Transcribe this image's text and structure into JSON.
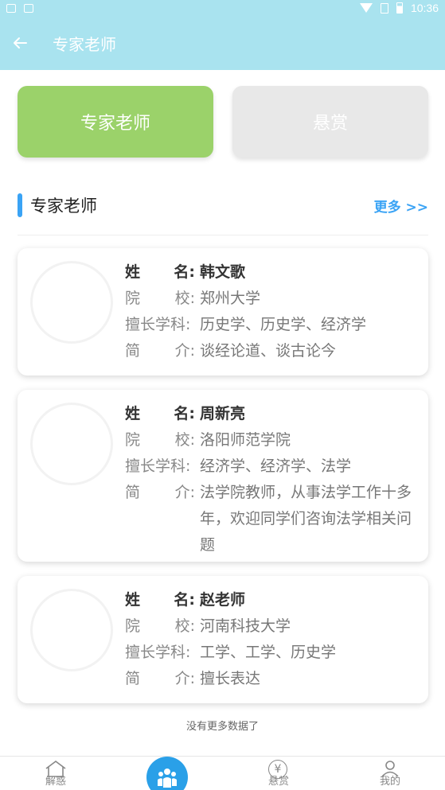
{
  "status_bar": {
    "time": "10:36"
  },
  "header": {
    "title": "专家老师",
    "back_icon": "arrow-left-icon"
  },
  "tabs": [
    {
      "label": "专家老师",
      "active": true,
      "color": "#9bd26a"
    },
    {
      "label": "悬赏",
      "active": false,
      "color": "#e8e8e8"
    }
  ],
  "section": {
    "title": "专家老师",
    "more": "更多 >>",
    "accent": "#3aa3f5"
  },
  "labels": {
    "name": [
      "姓",
      "名:"
    ],
    "school": [
      "院",
      "校:"
    ],
    "subject": [
      "擅长学科:"
    ],
    "intro": [
      "简",
      "介:"
    ]
  },
  "experts": [
    {
      "name": "韩文歌",
      "school": "郑州大学",
      "subjects": "历史学、历史学、经济学",
      "intro": "谈经论道、谈古论今"
    },
    {
      "name": "周新亮",
      "school": "洛阳师范学院",
      "subjects": "经济学、经济学、法学",
      "intro": "法学院教师，从事法学工作十多年，欢迎同学们咨询法学相关问题"
    },
    {
      "name": "赵老师",
      "school": "河南科技大学",
      "subjects": "工学、工学、历史学",
      "intro": "擅长表达"
    }
  ],
  "footer_note": "没有更多数据了",
  "bottom_nav": [
    {
      "label": "解惑",
      "icon": "house-icon"
    },
    {
      "label": "",
      "icon": "people-icon"
    },
    {
      "label": "悬赏",
      "icon": "yen-icon"
    },
    {
      "label": "我的",
      "icon": "user-icon"
    }
  ],
  "colors": {
    "header": "#a9e3ef",
    "nav_center": "#2aa0e8"
  }
}
